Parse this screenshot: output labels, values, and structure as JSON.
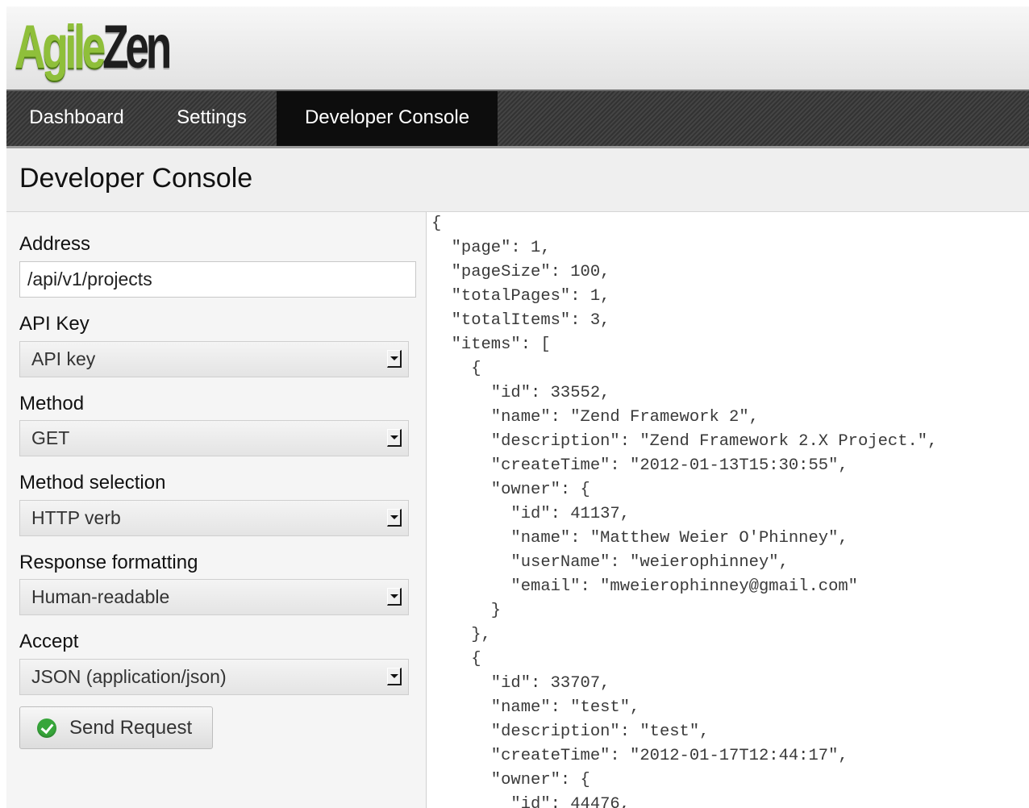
{
  "app": {
    "logo_part1": "Agile",
    "logo_part2": "Zen",
    "logo_color_green": "#8fbf3a"
  },
  "nav": {
    "items": [
      {
        "label": "Dashboard",
        "active": false
      },
      {
        "label": "Settings",
        "active": false
      },
      {
        "label": "Developer Console",
        "active": true
      }
    ]
  },
  "page": {
    "title": "Developer Console"
  },
  "form": {
    "address": {
      "label": "Address",
      "value": "/api/v1/projects"
    },
    "api_key": {
      "label": "API Key",
      "value": "API key"
    },
    "method": {
      "label": "Method",
      "value": "GET"
    },
    "method_selection": {
      "label": "Method selection",
      "value": "HTTP verb"
    },
    "response_formatting": {
      "label": "Response formatting",
      "value": "Human-readable"
    },
    "accept": {
      "label": "Accept",
      "value": "JSON (application/json)"
    },
    "send_button": {
      "label": "Send Request",
      "icon": "check-circle-icon"
    }
  },
  "response": {
    "lines": [
      "{",
      "  \"page\": 1,",
      "  \"pageSize\": 100,",
      "  \"totalPages\": 1,",
      "  \"totalItems\": 3,",
      "  \"items\": [",
      "    {",
      "      \"id\": 33552,",
      "      \"name\": \"Zend Framework 2\",",
      "      \"description\": \"Zend Framework 2.X Project.\",",
      "      \"createTime\": \"2012-01-13T15:30:55\",",
      "      \"owner\": {",
      "        \"id\": 41137,",
      "        \"name\": \"Matthew Weier O'Phinney\",",
      "        \"userName\": \"weierophinney\",",
      "        \"email\": \"mweierophinney@gmail.com\"",
      "      }",
      "    },",
      "    {",
      "      \"id\": 33707,",
      "      \"name\": \"test\",",
      "      \"description\": \"test\",",
      "      \"createTime\": \"2012-01-17T12:44:17\",",
      "      \"owner\": {",
      "        \"id\": 44476,"
    ]
  }
}
